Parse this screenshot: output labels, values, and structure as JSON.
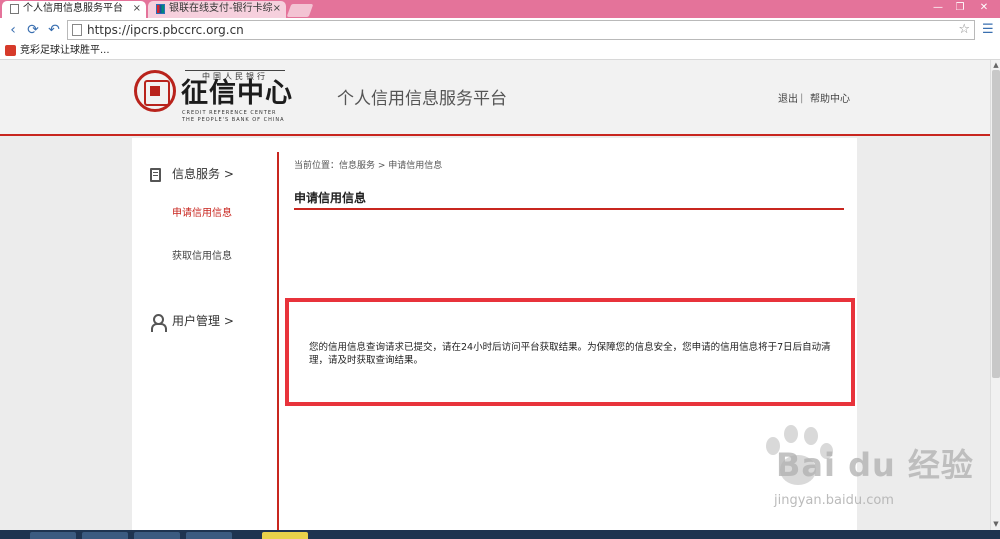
{
  "browser": {
    "tabs": [
      {
        "label": "个人信用信息服务平台",
        "active": true,
        "close": "×"
      },
      {
        "label": "银联在线支付-银行卡综合",
        "active": false,
        "close": "×"
      }
    ],
    "url": "https://ipcrs.pbccrc.org.cn",
    "bookmark_label": "竞彩足球让球胜平...",
    "window_controls": {
      "minimize": "—",
      "maximize": "❐",
      "close": "✕"
    }
  },
  "header": {
    "logo_top": "中国人民银行",
    "logo_name": "征信中心",
    "logo_en_line1": "CREDIT REFERENCE CENTER",
    "logo_en_line2": "THE PEOPLE'S BANK OF CHINA",
    "platform_title": "个人信用信息服务平台",
    "links": {
      "logout": "退出",
      "separator": "|",
      "help": "帮助中心"
    }
  },
  "sidebar": {
    "group1_title": "信息服务 >",
    "items": [
      {
        "label": "申请信用信息",
        "active": true
      },
      {
        "label": "获取信用信息",
        "active": false
      }
    ],
    "group2_title": "用户管理 >"
  },
  "main": {
    "breadcrumb": "当前位置：信息服务 > 申请信用信息",
    "section_title": "申请信用信息",
    "message": "您的信用信息查询请求已提交，请在24小时后访问平台获取结果。为保障您的信息安全，您申请的信用信息将于7日后自动清理，请及时获取查询结果。"
  },
  "watermark": {
    "brand": "Bai du 经验",
    "url": "jingyan.baidu.com"
  },
  "colors": {
    "accent": "#c8261f",
    "highlight_box": "#e8333b",
    "titlebar": "#e4739a"
  },
  "icons": {
    "tab_page": "page-icon",
    "tab_unionpay": "unionpay-icon",
    "back": "back-arrow-icon",
    "forward": "forward-arrow-icon",
    "reload": "reload-icon",
    "undo": "undo-icon",
    "star": "star-icon",
    "menu": "menu-icon",
    "bookmark": "lottery-icon",
    "seal": "seal-icon",
    "info_service": "document-icon",
    "user_management": "user-icon"
  }
}
